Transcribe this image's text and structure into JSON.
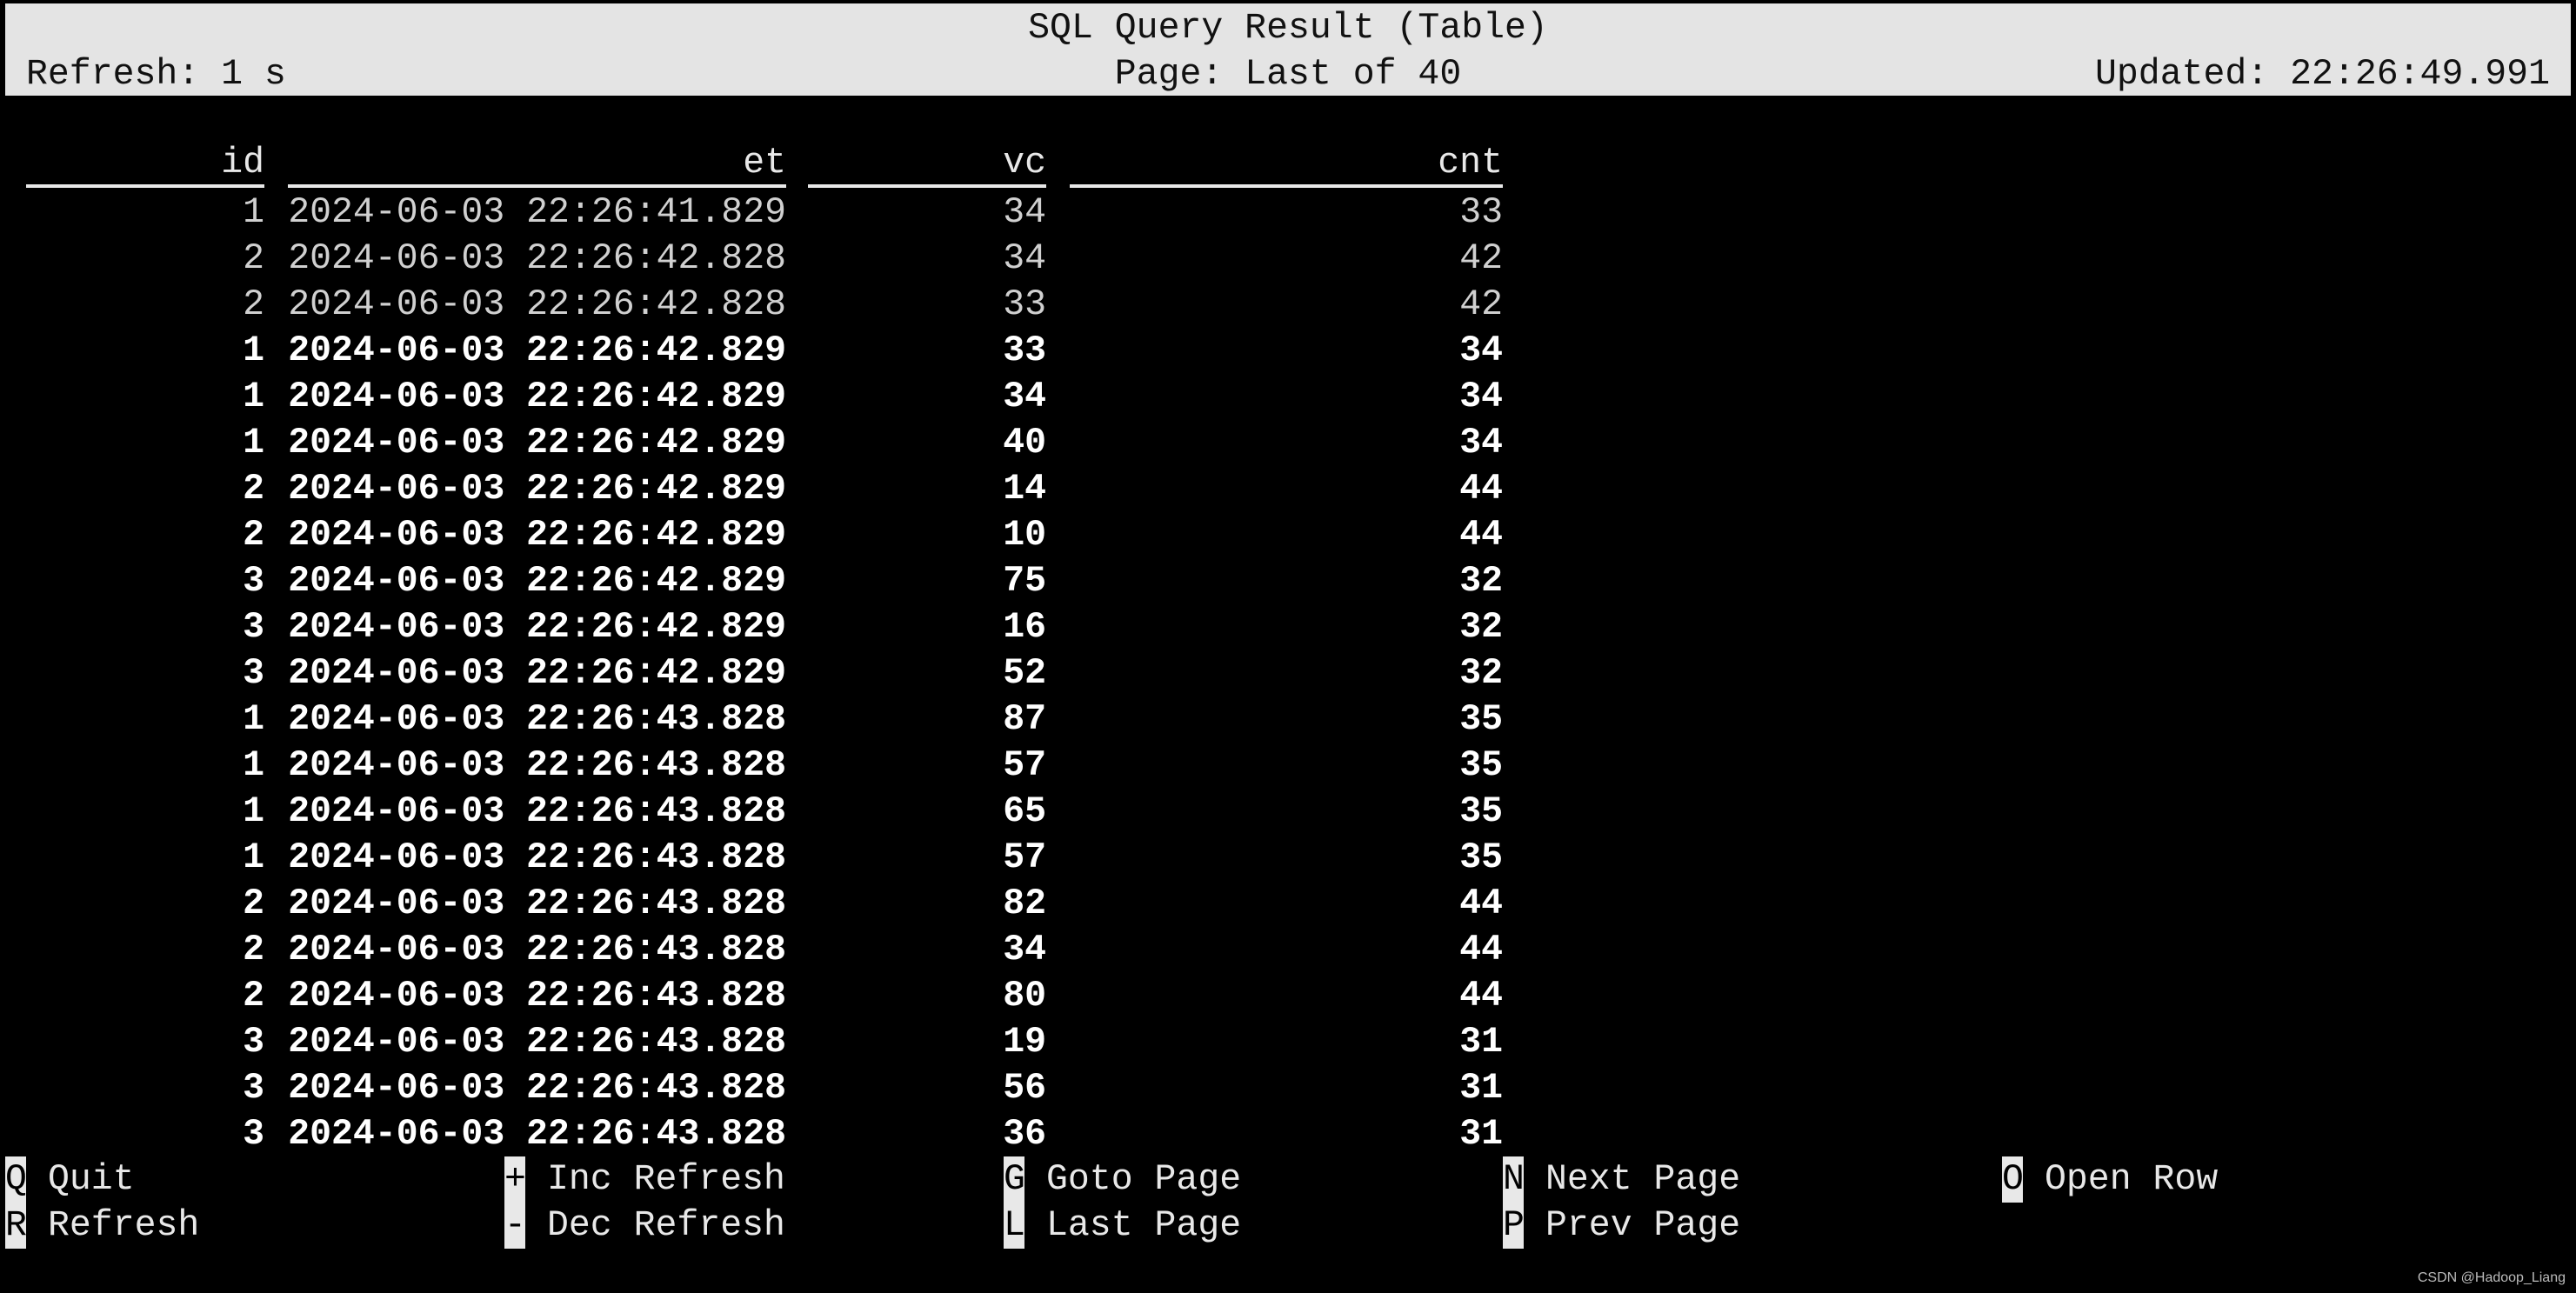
{
  "header": {
    "title": "SQL Query Result (Table)",
    "refresh": "Refresh: 1 s",
    "page": "Page: Last of 40",
    "updated": "Updated: 22:26:49.991"
  },
  "table": {
    "columns": [
      "id",
      "et",
      "vc",
      "cnt"
    ],
    "rows": [
      {
        "id": "1",
        "et": "2024-06-03 22:26:41.829",
        "vc": "34",
        "cnt": "33",
        "highlight": false
      },
      {
        "id": "2",
        "et": "2024-06-03 22:26:42.828",
        "vc": "34",
        "cnt": "42",
        "highlight": false
      },
      {
        "id": "2",
        "et": "2024-06-03 22:26:42.828",
        "vc": "33",
        "cnt": "42",
        "highlight": false
      },
      {
        "id": "1",
        "et": "2024-06-03 22:26:42.829",
        "vc": "33",
        "cnt": "34",
        "highlight": true
      },
      {
        "id": "1",
        "et": "2024-06-03 22:26:42.829",
        "vc": "34",
        "cnt": "34",
        "highlight": true
      },
      {
        "id": "1",
        "et": "2024-06-03 22:26:42.829",
        "vc": "40",
        "cnt": "34",
        "highlight": true
      },
      {
        "id": "2",
        "et": "2024-06-03 22:26:42.829",
        "vc": "14",
        "cnt": "44",
        "highlight": true
      },
      {
        "id": "2",
        "et": "2024-06-03 22:26:42.829",
        "vc": "10",
        "cnt": "44",
        "highlight": true
      },
      {
        "id": "3",
        "et": "2024-06-03 22:26:42.829",
        "vc": "75",
        "cnt": "32",
        "highlight": true
      },
      {
        "id": "3",
        "et": "2024-06-03 22:26:42.829",
        "vc": "16",
        "cnt": "32",
        "highlight": true
      },
      {
        "id": "3",
        "et": "2024-06-03 22:26:42.829",
        "vc": "52",
        "cnt": "32",
        "highlight": true
      },
      {
        "id": "1",
        "et": "2024-06-03 22:26:43.828",
        "vc": "87",
        "cnt": "35",
        "highlight": true
      },
      {
        "id": "1",
        "et": "2024-06-03 22:26:43.828",
        "vc": "57",
        "cnt": "35",
        "highlight": true
      },
      {
        "id": "1",
        "et": "2024-06-03 22:26:43.828",
        "vc": "65",
        "cnt": "35",
        "highlight": true
      },
      {
        "id": "1",
        "et": "2024-06-03 22:26:43.828",
        "vc": "57",
        "cnt": "35",
        "highlight": true
      },
      {
        "id": "2",
        "et": "2024-06-03 22:26:43.828",
        "vc": "82",
        "cnt": "44",
        "highlight": true
      },
      {
        "id": "2",
        "et": "2024-06-03 22:26:43.828",
        "vc": "34",
        "cnt": "44",
        "highlight": true
      },
      {
        "id": "2",
        "et": "2024-06-03 22:26:43.828",
        "vc": "80",
        "cnt": "44",
        "highlight": true
      },
      {
        "id": "3",
        "et": "2024-06-03 22:26:43.828",
        "vc": "19",
        "cnt": "31",
        "highlight": true
      },
      {
        "id": "3",
        "et": "2024-06-03 22:26:43.828",
        "vc": "56",
        "cnt": "31",
        "highlight": true
      },
      {
        "id": "3",
        "et": "2024-06-03 22:26:43.828",
        "vc": "36",
        "cnt": "31",
        "highlight": true
      }
    ]
  },
  "footer": {
    "shortcuts": [
      {
        "key": "Q",
        "label": "Quit"
      },
      {
        "key": "R",
        "label": "Refresh"
      },
      {
        "key": "+",
        "label": "Inc Refresh"
      },
      {
        "key": "-",
        "label": "Dec Refresh"
      },
      {
        "key": "G",
        "label": "Goto Page"
      },
      {
        "key": "L",
        "label": "Last Page"
      },
      {
        "key": "N",
        "label": "Next Page"
      },
      {
        "key": "P",
        "label": "Prev Page"
      },
      {
        "key": "O",
        "label": "Open Row"
      }
    ]
  },
  "watermark": "CSDN @Hadoop_Liang"
}
